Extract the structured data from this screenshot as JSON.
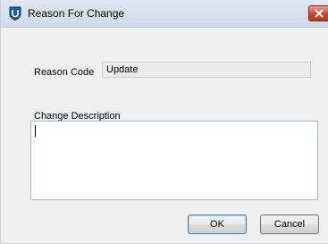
{
  "window": {
    "title": "Reason For Change",
    "app_icon": "shield-icon",
    "close_icon": "close-icon"
  },
  "form": {
    "reason_code_label": "Reason Code",
    "reason_code_value": "Update",
    "change_description_label": "Change Description",
    "change_description_value": ""
  },
  "buttons": {
    "ok_label": "OK",
    "cancel_label": "Cancel"
  },
  "colors": {
    "titlebar": "#dde7f3",
    "close_button": "#c7472f",
    "app_icon": "#1a5a9e",
    "focus_border": "#3c7fb1"
  }
}
